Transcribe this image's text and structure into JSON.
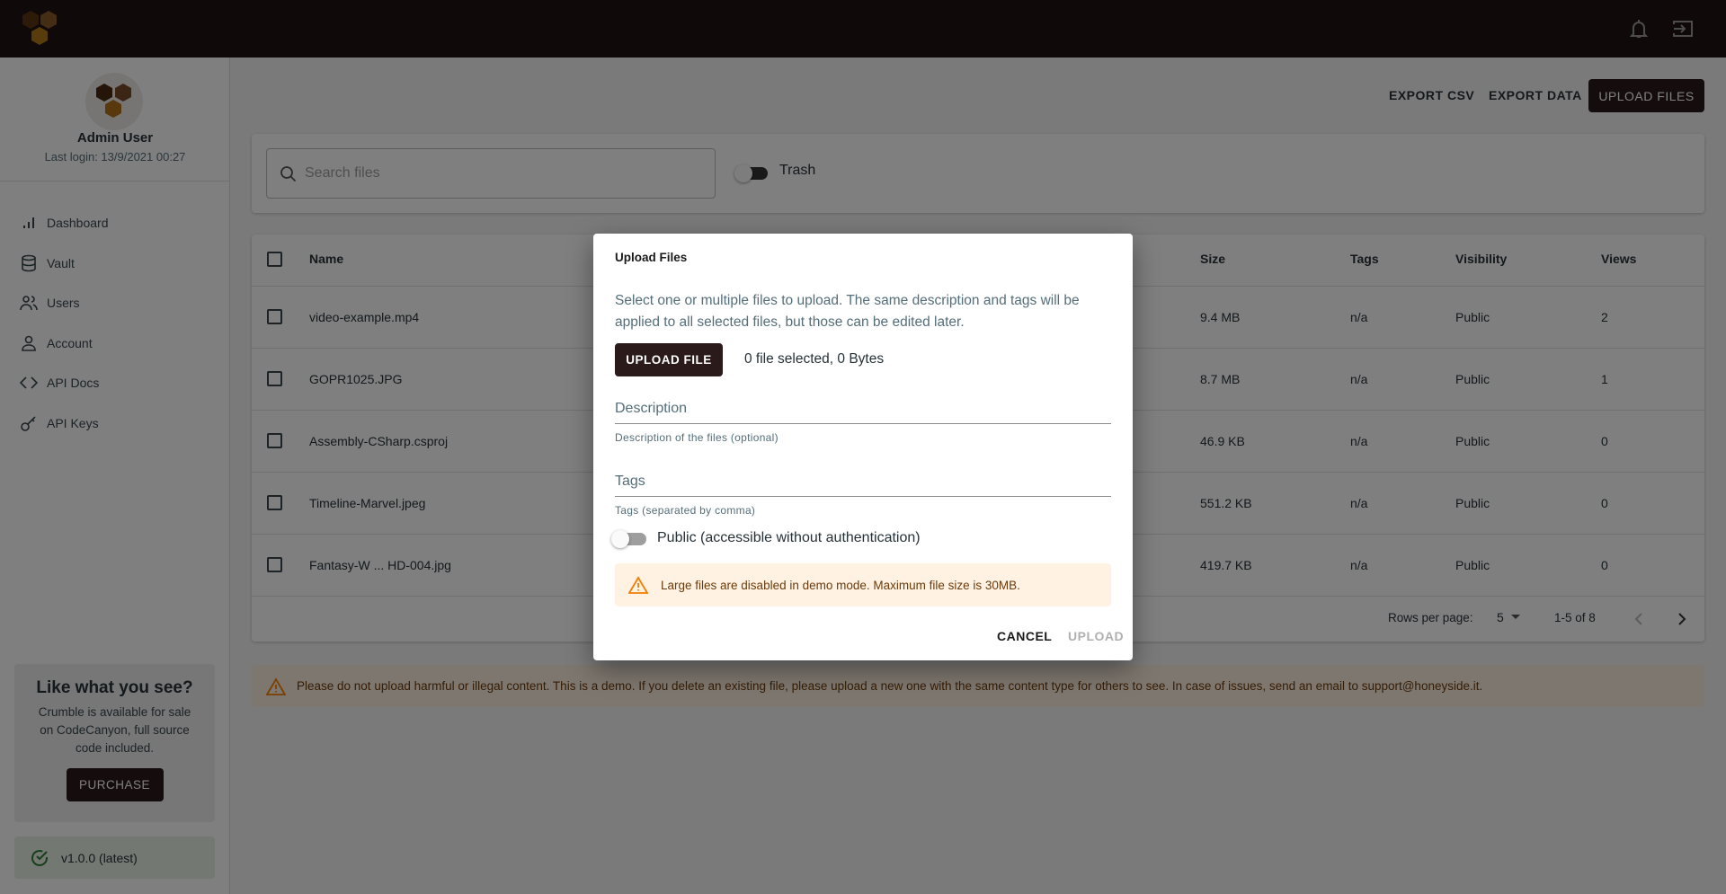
{
  "topbar": {
    "icons": [
      "logo-hexagons",
      "bell-icon",
      "logout-icon"
    ]
  },
  "sidebar": {
    "user_name": "Admin User",
    "last_login": "Last login: 13/9/2021 00:27",
    "items": [
      {
        "label": "Dashboard",
        "icon": "bar-chart-icon"
      },
      {
        "label": "Vault",
        "icon": "database-icon"
      },
      {
        "label": "Users",
        "icon": "users-icon"
      },
      {
        "label": "Account",
        "icon": "user-icon"
      },
      {
        "label": "API Docs",
        "icon": "code-icon"
      },
      {
        "label": "API Keys",
        "icon": "key-icon"
      }
    ],
    "promo": {
      "title": "Like what you see?",
      "text": "Crumble is available for sale on CodeCanyon, full source code included.",
      "button": "PURCHASE"
    },
    "version": "v1.0.0 (latest)"
  },
  "toolbar": {
    "export_csv": "EXPORT CSV",
    "export_data": "EXPORT DATA",
    "upload_files": "UPLOAD FILES"
  },
  "search": {
    "placeholder": "Search files",
    "trash_label": "Trash"
  },
  "table": {
    "headers": {
      "name": "Name",
      "size": "Size",
      "tags": "Tags",
      "visibility": "Visibility",
      "views": "Views"
    },
    "rows": [
      {
        "name": "video-example.mp4",
        "size": "9.4 MB",
        "tags": "n/a",
        "visibility": "Public",
        "views": "2"
      },
      {
        "name": "GOPR1025.JPG",
        "size": "8.7 MB",
        "tags": "n/a",
        "visibility": "Public",
        "views": "1"
      },
      {
        "name": "Assembly-CSharp.csproj",
        "size": "46.9 KB",
        "tags": "n/a",
        "visibility": "Public",
        "views": "0"
      },
      {
        "name": "Timeline-Marvel.jpeg",
        "size": "551.2 KB",
        "tags": "n/a",
        "visibility": "Public",
        "views": "0"
      },
      {
        "name": "Fantasy-W ... HD-004.jpg",
        "size": "419.7 KB",
        "tags": "n/a",
        "visibility": "Public",
        "views": "0"
      }
    ],
    "pagination": {
      "rows_per_page_label": "Rows per page:",
      "rows_per_page": "5",
      "range": "1-5 of 8"
    }
  },
  "banner": {
    "text": "Please do not upload harmful or illegal content. This is a demo. If you delete an existing file, please upload a new one with the same content type for others to see. In case of issues, send an email to support@honeyside.it."
  },
  "dialog": {
    "title": "Upload Files",
    "description": "Select one or multiple files to upload. The same description and tags will be applied to all selected files, but those can be edited later.",
    "upload_file_button": "UPLOAD FILE",
    "selection_status": "0 file selected, 0 Bytes",
    "description_field": {
      "label": "Description",
      "helper": "Description of the files (optional)",
      "value": ""
    },
    "tags_field": {
      "label": "Tags",
      "helper": "Tags (separated by comma)",
      "value": ""
    },
    "public_toggle": {
      "label": "Public (accessible without authentication)",
      "checked": false
    },
    "alert": "Large files are disabled in demo mode. Maximum file size is 30MB.",
    "cancel": "CANCEL",
    "upload": "UPLOAD"
  },
  "colors": {
    "brand_dark": "#1e1212",
    "button_dark": "#2a1a1a",
    "warning": "#f57c00",
    "success": "#2e7d32"
  }
}
